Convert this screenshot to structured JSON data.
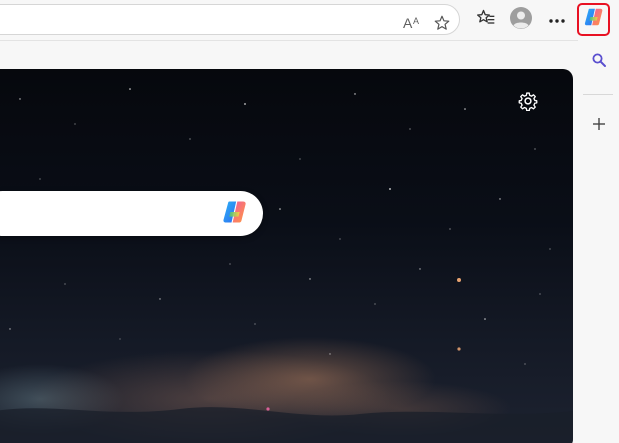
{
  "toolbar": {
    "address_value": "",
    "read_aloud_icon": "read-aloud-icon",
    "favorite_icon": "star-outline-icon",
    "favorites_icon": "favorites-list-icon",
    "profile_icon": "profile-avatar-icon",
    "more_icon": "more-dots-icon",
    "copilot_icon": "copilot-icon",
    "copilot_highlight_color": "#e81123"
  },
  "sidebar": {
    "search_icon": "search-icon",
    "add_icon": "plus-icon"
  },
  "content": {
    "background": "night-sky-milky-way",
    "settings_icon": "gear-icon",
    "search": {
      "value": "",
      "copilot_icon": "copilot-icon"
    }
  }
}
